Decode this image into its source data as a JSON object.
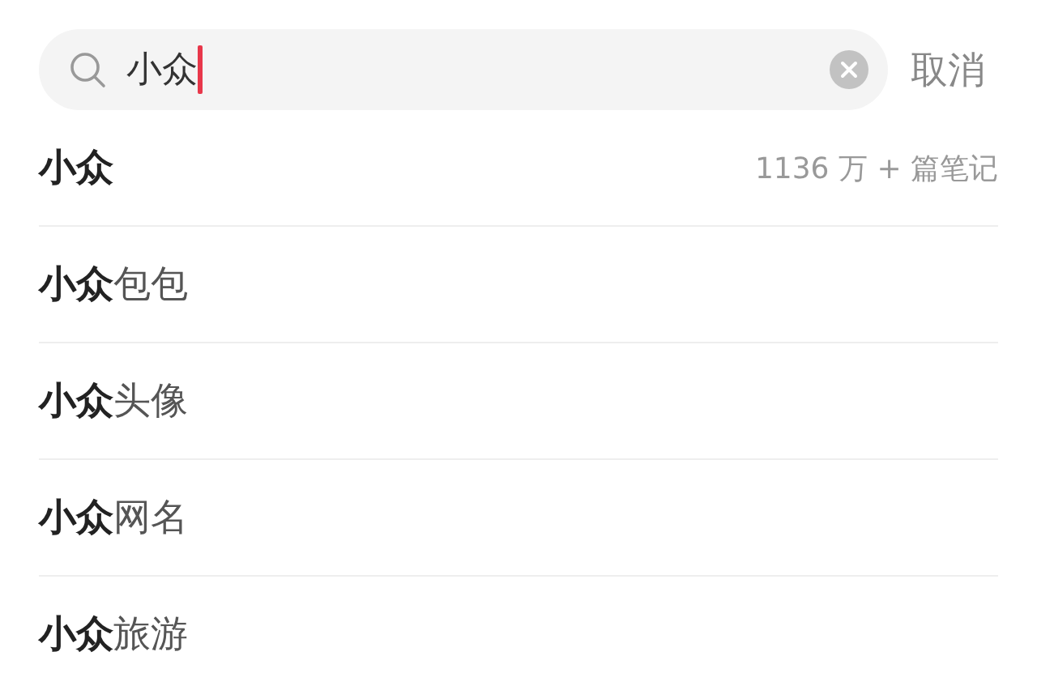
{
  "search": {
    "value": "小众",
    "cancel": "取消"
  },
  "suggestions": [
    {
      "kind": "exact",
      "text": "小众",
      "count": "1136 万 + 篇笔记"
    },
    {
      "kind": "partial",
      "text": "**小众**包包"
    },
    {
      "kind": "partial",
      "text": "**小众**头像"
    },
    {
      "kind": "partial",
      "text": "**小众**网名"
    },
    {
      "kind": "partial",
      "text": "**小众**旅游"
    }
  ]
}
